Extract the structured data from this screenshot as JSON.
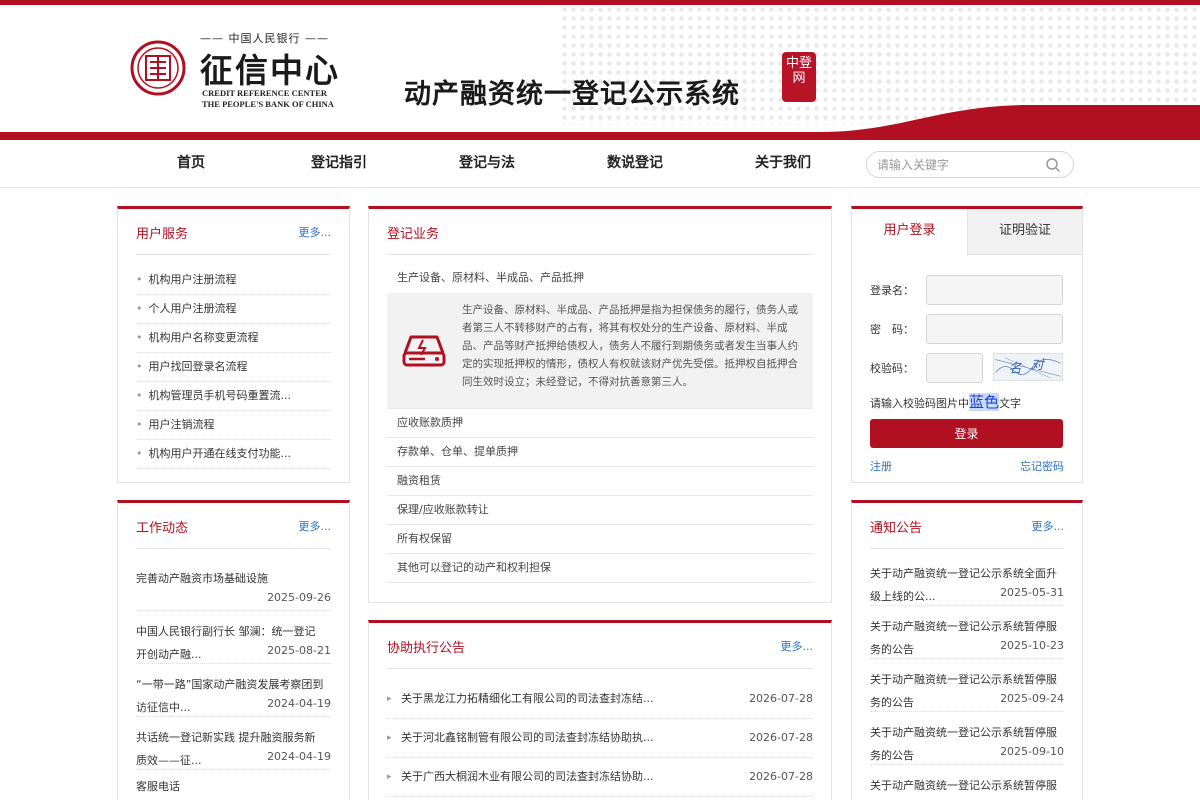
{
  "header": {
    "logo_small": "—— 中国人民银行 ——",
    "logo_name": "征信中心",
    "logo_en_line1": "CREDIT REFERENCE CENTER",
    "logo_en_line2": "THE PEOPLE'S BANK OF CHINA",
    "system_title": "动产融资统一登记公示系统",
    "stamp_text": "中登网"
  },
  "nav": {
    "items": [
      "首页",
      "登记指引",
      "登记与法",
      "数说登记",
      "关于我们"
    ],
    "search_placeholder": "请输入关键字"
  },
  "user_service": {
    "title": "用户服务",
    "more": "更多...",
    "items": [
      "机构用户注册流程",
      "个人用户注册流程",
      "机构用户名称变更流程",
      "用户找回登录名流程",
      "机构管理员手机号码重置流...",
      "用户注销流程",
      "机构用户开通在线支付功能..."
    ]
  },
  "work_news": {
    "title": "工作动态",
    "more": "更多...",
    "items": [
      {
        "title": "完善动产融资市场基础设施",
        "date": "2025-09-26"
      },
      {
        "title": "中国人民银行副行长 邹澜：统一登记开创动产融...",
        "date": "2025-08-21"
      },
      {
        "title": "“一带一路”国家动产融资发展考察团到访征信中...",
        "date": "2024-04-19"
      },
      {
        "title": "共话统一登记新实践 提升融资服务新质效——征...",
        "date": "2024-04-19"
      }
    ],
    "footer_partial": "客服电话"
  },
  "registration": {
    "title": "登记业务",
    "expanded_label": "生产设备、原材料、半成品、产品抵押",
    "expanded_desc": "生产设备、原材料、半成品、产品抵押是指为担保债务的履行，债务人或者第三人不转移财产的占有，将其有权处分的生产设备、原材料、半成品、产品等财产抵押给债权人，债务人不履行到期债务或者发生当事人约定的实现抵押权的情形，债权人有权就该财产优先受偿。抵押权自抵押合同生效时设立；未经登记，不得对抗善意第三人。",
    "items": [
      "应收账款质押",
      "存款单、仓单、提单质押",
      "融资租赁",
      "保理/应收账款转让",
      "所有权保留",
      "其他可以登记的动产和权利担保"
    ]
  },
  "assist": {
    "title": "协助执行公告",
    "more": "更多...",
    "items": [
      {
        "title": "关于黑龙江力拓精细化工有限公司的司法查封冻结...",
        "date": "2026-07-28"
      },
      {
        "title": "关于河北鑫铭制管有限公司的司法查封冻结协助执...",
        "date": "2026-07-28"
      },
      {
        "title": "关于广西大桐润木业有限公司的司法查封冻结协助...",
        "date": "2026-07-28"
      }
    ]
  },
  "login": {
    "tab_login": "用户登录",
    "tab_verify": "证明验证",
    "username_label": "登录名：",
    "password_label": "密　码：",
    "code_label": "校验码：",
    "hint_prefix": "请输入校验码图片中",
    "hint_color": "蓝色",
    "hint_suffix": "文字",
    "login_button": "登录",
    "register": "注册",
    "forgot": "忘记密码"
  },
  "announcements": {
    "title": "通知公告",
    "more": "更多...",
    "items": [
      {
        "title": "关于动产融资统一登记公示系统全面升级上线的公...",
        "date": "2025-05-31"
      },
      {
        "title": "关于动产融资统一登记公示系统暂停服务的公告",
        "date": "2025-10-23"
      },
      {
        "title": "关于动产融资统一登记公示系统暂停服务的公告",
        "date": "2025-09-24"
      },
      {
        "title": "关于动产融资统一登记公示系统暂停服务的公告",
        "date": "2025-09-10"
      },
      {
        "title": "关于动产融资统一登记公示系统暂停服",
        "date": ""
      }
    ]
  },
  "colors": {
    "brand_red": "#b01020",
    "link_blue": "#2a6fc9"
  }
}
